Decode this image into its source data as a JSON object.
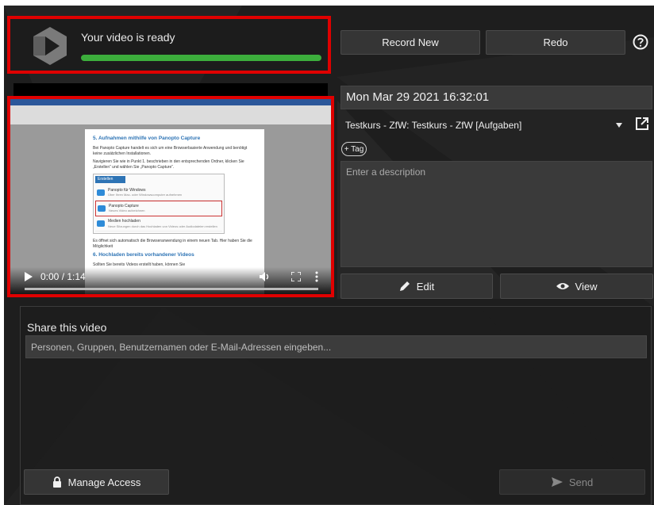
{
  "status": {
    "message": "Your video is ready",
    "progress": 1.0
  },
  "toolbar": {
    "record_new_label": "Record New",
    "redo_label": "Redo",
    "help_icon": "question-circle-icon"
  },
  "video": {
    "time": "0:00 / 1:14",
    "document": {
      "heading1": "5. Aufnahmen mithilfe von Panopto Capture",
      "para1": "Bei Panopto Capture handelt es sich um eine Browserbasierte Anwendung und benötigt keine zusätzlichen Installationen.",
      "para2": "Navigieren Sie wie in Punkt 1. beschrieben in den entsprechenden Ordner, klicken Sie „Erstellen“ und wählen Sie „Panopto Capture“.",
      "menu_header": "Erstellen",
      "menu_items": [
        {
          "title": "Panopto für Windows",
          "sub": "Über Ihren Mac- oder Windowscomputer aufnehmen"
        },
        {
          "title": "Panopto Capture",
          "sub": "Neues Video aufzeichnen"
        },
        {
          "title": "Medien hochladen",
          "sub": "Neue Sitzungen durch das Hochladen von Videos oder Audiodateien erstellen"
        }
      ],
      "para3": "Es öffnet sich automatisch die Browseranwendung in einem neuen Tab. Hier haben Sie die Möglichkeit",
      "heading2": "6. Hochladen bereits vorhandener Videos",
      "para4": "Sollten Sie bereits Videos erstellt haben, können Sie"
    }
  },
  "details": {
    "date": "Mon Mar 29 2021 16:32:01",
    "folder": "Testkurs - ZfW: Testkurs - ZfW [Aufgaben]",
    "tag_label": "+ Tag",
    "description_placeholder": "Enter a description",
    "edit_label": "Edit",
    "view_label": "View"
  },
  "share": {
    "title": "Share this video",
    "input_placeholder": "Personen, Gruppen, Benutzernamen oder E-Mail-Adressen eingeben...",
    "manage_access_label": "Manage Access",
    "send_label": "Send"
  },
  "colors": {
    "highlight": "#e00000",
    "progress": "#3cae3c",
    "background": "#1e1e1e"
  }
}
